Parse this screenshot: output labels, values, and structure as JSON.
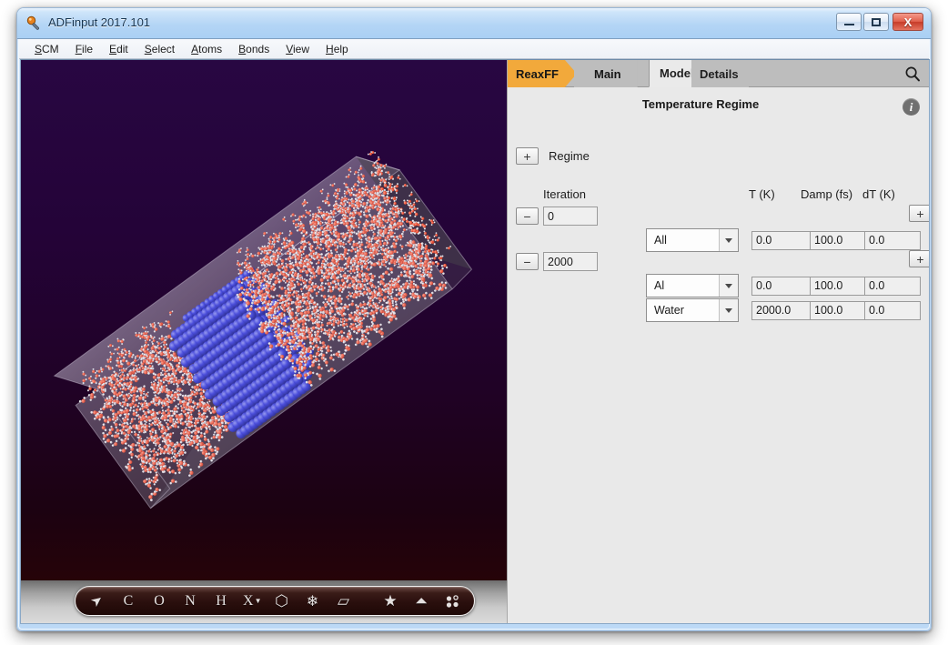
{
  "window": {
    "title": "ADFinput 2017.101",
    "icon": "app-wand-icon",
    "controls": {
      "minimize_label": "Minimize",
      "maximize_label": "Maximize",
      "close_label": "X"
    }
  },
  "menubar": {
    "items": [
      {
        "label": "SCM",
        "mnemonic": "S"
      },
      {
        "label": "File",
        "mnemonic": "F"
      },
      {
        "label": "Edit",
        "mnemonic": "E"
      },
      {
        "label": "Select",
        "mnemonic": "S"
      },
      {
        "label": "Atoms",
        "mnemonic": "A"
      },
      {
        "label": "Bonds",
        "mnemonic": "B"
      },
      {
        "label": "View",
        "mnemonic": "V"
      },
      {
        "label": "Help",
        "mnemonic": "H"
      }
    ]
  },
  "viewport": {
    "background_top": "#250338",
    "background_bottom": "#2b0403",
    "atom_colors": {
      "aluminium": "#2b2fd4",
      "oxygen": "#f05a42",
      "hydrogen": "#e8e8e8",
      "cell_box": "#b9aec4"
    },
    "toolbar": {
      "items": [
        {
          "name": "select-arrow-icon",
          "glyph": "➤"
        },
        {
          "name": "carbon-icon",
          "glyph": "C"
        },
        {
          "name": "oxygen-icon",
          "glyph": "O"
        },
        {
          "name": "nitrogen-icon",
          "glyph": "N"
        },
        {
          "name": "hydrogen-icon",
          "glyph": "H"
        },
        {
          "name": "element-picker-icon",
          "glyph": "X"
        },
        {
          "name": "ring-icon",
          "glyph": "⬡"
        },
        {
          "name": "crystal-icon",
          "glyph": "❄"
        },
        {
          "name": "plane-icon",
          "glyph": "▱"
        },
        {
          "name": "favourite-icon",
          "glyph": "★"
        },
        {
          "name": "unit-cell-icon",
          "glyph": "⛶"
        },
        {
          "name": "atoms-dots-icon",
          "glyph": "⁙"
        }
      ]
    }
  },
  "panel": {
    "tabs": [
      {
        "id": "reaxff",
        "label": "ReaxFF",
        "active": false,
        "accent": "#f2a93b"
      },
      {
        "id": "main",
        "label": "Main",
        "active": false
      },
      {
        "id": "model",
        "label": "Model",
        "active": true
      },
      {
        "id": "details",
        "label": "Details",
        "active": false
      }
    ],
    "search_icon": "search-icon",
    "title": "Temperature Regime",
    "info_icon": "info-icon",
    "info_glyph": "i",
    "add_regime": {
      "button_label": "+",
      "label": "Regime"
    },
    "columns": {
      "iteration": "Iteration",
      "t": "T (K)",
      "damp": "Damp (fs)",
      "dt": "dT (K)"
    },
    "iterations": [
      {
        "remove_label": "−",
        "value": "0"
      },
      {
        "remove_label": "−",
        "value": "2000"
      }
    ],
    "edge_add_buttons": [
      {
        "label": "+"
      },
      {
        "label": "+"
      }
    ],
    "regimes": [
      {
        "region": "All",
        "t": "0.0",
        "damp": "100.0",
        "dt": "0.0",
        "remove_label": "−"
      },
      {
        "region": "Al",
        "t": "0.0",
        "damp": "100.0",
        "dt": "0.0",
        "remove_label": "−"
      },
      {
        "region": "Water",
        "t": "2000.0",
        "damp": "100.0",
        "dt": "0.0",
        "remove_label": "−"
      }
    ]
  }
}
